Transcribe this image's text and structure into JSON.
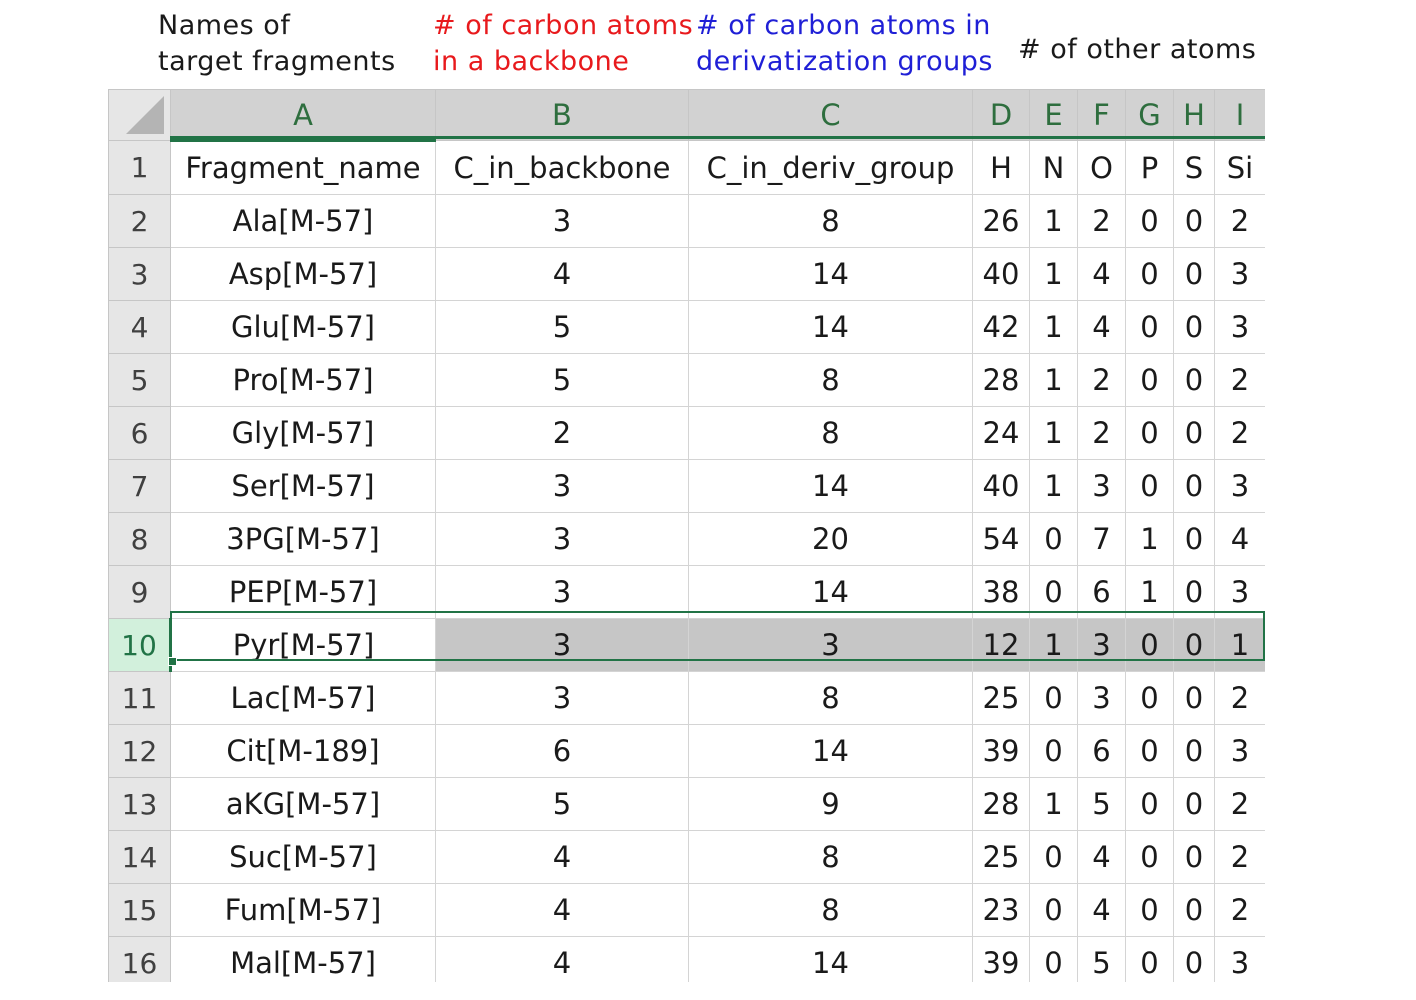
{
  "annotations": {
    "names_line1": "Names of",
    "names_line2": "target fragments",
    "backbone_line1": "# of carbon atoms",
    "backbone_line2": "in a backbone",
    "deriv_line1": "# of carbon atoms in",
    "deriv_line2": "derivatization groups",
    "other": "# of other atoms",
    "colors": {
      "names": "#1a1a1a",
      "backbone": "#e8191c",
      "deriv": "#1f1fd6",
      "other": "#1a1a1a"
    }
  },
  "spreadsheet": {
    "column_letters": [
      "A",
      "B",
      "C",
      "D",
      "E",
      "F",
      "G",
      "H",
      "I"
    ],
    "selected_row": 10,
    "active_cell": "A10",
    "accent_color": "#217346",
    "rows": [
      {
        "n": "1",
        "cells": [
          "Fragment_name",
          "C_in_backbone",
          "C_in_deriv_group",
          "H",
          "N",
          "O",
          "P",
          "S",
          "Si"
        ]
      },
      {
        "n": "2",
        "cells": [
          "Ala[M-57]",
          "3",
          "8",
          "26",
          "1",
          "2",
          "0",
          "0",
          "2"
        ]
      },
      {
        "n": "3",
        "cells": [
          "Asp[M-57]",
          "4",
          "14",
          "40",
          "1",
          "4",
          "0",
          "0",
          "3"
        ]
      },
      {
        "n": "4",
        "cells": [
          "Glu[M-57]",
          "5",
          "14",
          "42",
          "1",
          "4",
          "0",
          "0",
          "3"
        ]
      },
      {
        "n": "5",
        "cells": [
          "Pro[M-57]",
          "5",
          "8",
          "28",
          "1",
          "2",
          "0",
          "0",
          "2"
        ]
      },
      {
        "n": "6",
        "cells": [
          "Gly[M-57]",
          "2",
          "8",
          "24",
          "1",
          "2",
          "0",
          "0",
          "2"
        ]
      },
      {
        "n": "7",
        "cells": [
          "Ser[M-57]",
          "3",
          "14",
          "40",
          "1",
          "3",
          "0",
          "0",
          "3"
        ]
      },
      {
        "n": "8",
        "cells": [
          "3PG[M-57]",
          "3",
          "20",
          "54",
          "0",
          "7",
          "1",
          "0",
          "4"
        ]
      },
      {
        "n": "9",
        "cells": [
          "PEP[M-57]",
          "3",
          "14",
          "38",
          "0",
          "6",
          "1",
          "0",
          "3"
        ]
      },
      {
        "n": "10",
        "cells": [
          "Pyr[M-57]",
          "3",
          "3",
          "12",
          "1",
          "3",
          "0",
          "0",
          "1"
        ]
      },
      {
        "n": "11",
        "cells": [
          "Lac[M-57]",
          "3",
          "8",
          "25",
          "0",
          "3",
          "0",
          "0",
          "2"
        ]
      },
      {
        "n": "12",
        "cells": [
          "Cit[M-189]",
          "6",
          "14",
          "39",
          "0",
          "6",
          "0",
          "0",
          "3"
        ]
      },
      {
        "n": "13",
        "cells": [
          "aKG[M-57]",
          "5",
          "9",
          "28",
          "1",
          "5",
          "0",
          "0",
          "2"
        ]
      },
      {
        "n": "14",
        "cells": [
          "Suc[M-57]",
          "4",
          "8",
          "25",
          "0",
          "4",
          "0",
          "0",
          "2"
        ]
      },
      {
        "n": "15",
        "cells": [
          "Fum[M-57]",
          "4",
          "8",
          "23",
          "0",
          "4",
          "0",
          "0",
          "2"
        ]
      },
      {
        "n": "16",
        "cells": [
          "Mal[M-57]",
          "4",
          "14",
          "39",
          "0",
          "5",
          "0",
          "0",
          "3"
        ]
      }
    ]
  }
}
